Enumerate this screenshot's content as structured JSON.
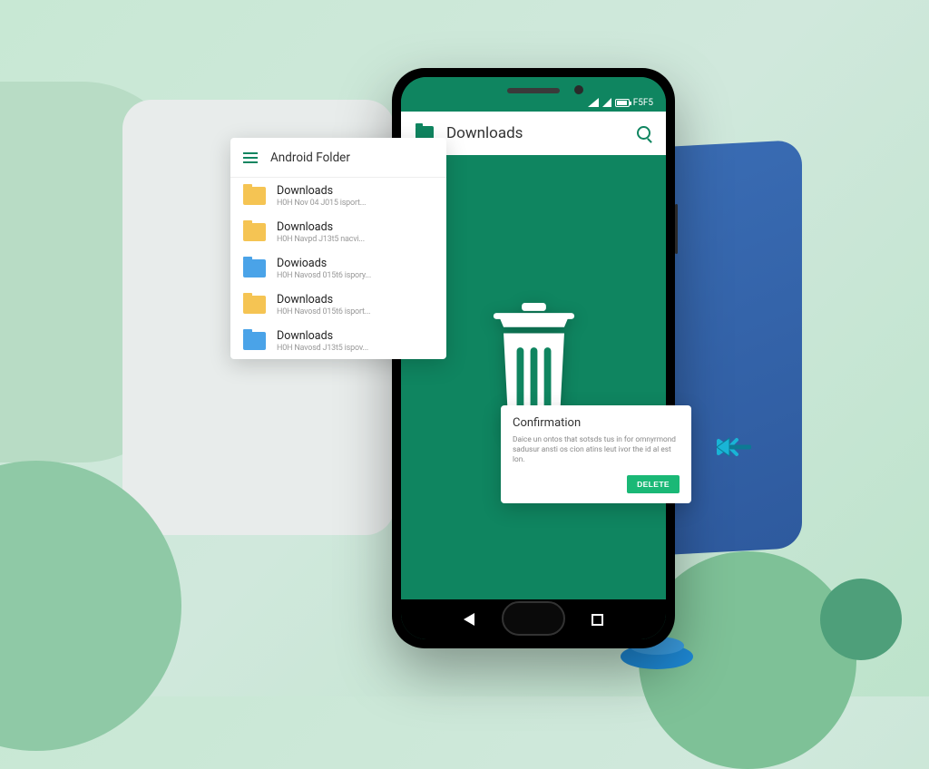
{
  "status_bar": {
    "time_label": "F5F5"
  },
  "app_bar": {
    "title": "Downloads"
  },
  "folder_popup": {
    "title": "Android Folder",
    "items": [
      {
        "name": "Downloads",
        "meta": "H0H  Nov 04 J015 isport...",
        "color": "yellow"
      },
      {
        "name": "Downloads",
        "meta": "H0H  Navpd J13t5 nacvi...",
        "color": "yellow"
      },
      {
        "name": "Dowioads",
        "meta": "H0H  Navosd 015t6 ispory...",
        "color": "blue"
      },
      {
        "name": "Downloads",
        "meta": "H0H  Navosd 015t6 isport...",
        "color": "yellow"
      },
      {
        "name": "Downloads",
        "meta": "H0H  Navosd J13t5 ispov...",
        "color": "blue"
      }
    ]
  },
  "confirm": {
    "title": "Confirmation",
    "body": "Daice un ontos that sotsds tus in for omnyrmond sadusur ansti os cion atins leut ivor the id al est lon.",
    "button": "DELETE"
  },
  "colors": {
    "primary": "#0f8560",
    "accent_green": "#1ab876",
    "accent_blue": "#1e88d4"
  }
}
